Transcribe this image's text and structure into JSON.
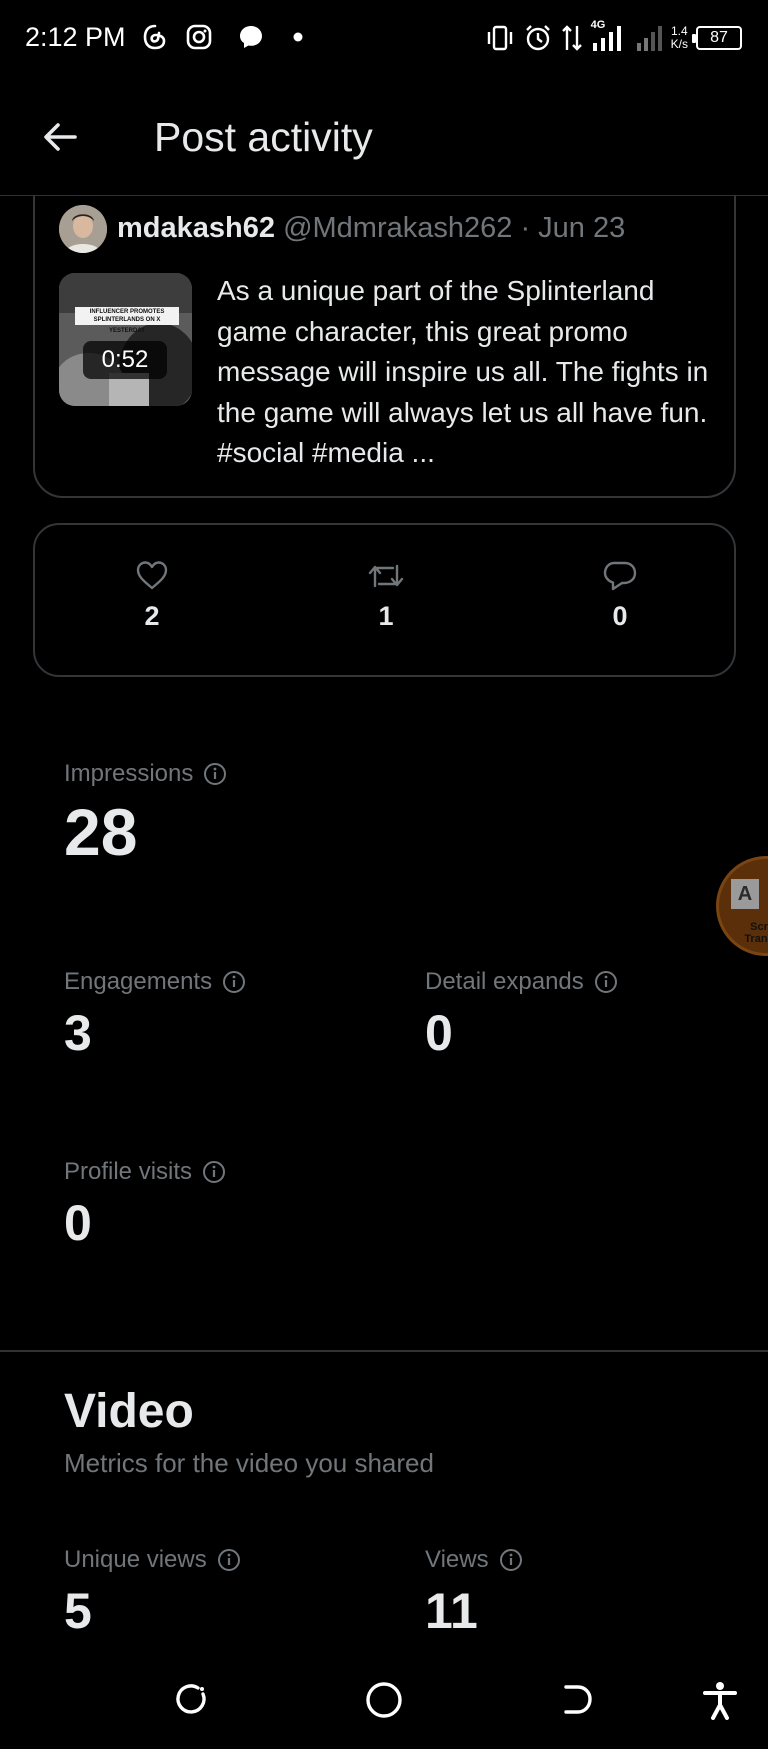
{
  "status_bar": {
    "time": "2:12 PM",
    "net_speed_value": "1.4",
    "net_speed_unit": "K/s",
    "network_type": "4G",
    "battery": "87",
    "icons": [
      "threads-icon",
      "instagram-icon",
      "messenger-icon",
      "notification-dot-icon",
      "vibrate-icon",
      "alarm-icon",
      "data-arrows-icon",
      "signal-icon",
      "signal-icon-2"
    ]
  },
  "header": {
    "title": "Post activity",
    "back_icon": "arrow-left-icon"
  },
  "post": {
    "author": "mdakash62",
    "handle": "@Mdmrakash262",
    "separator": "·",
    "date": "Jun 23",
    "text": "As a unique part of the Splinterland game character, this great promo message will inspire us all. The fights in the game will always let us all have fun. #social #media ...",
    "thumbnail": {
      "banner_line1": "INFLUENCER PROMOTES",
      "banner_line2": "SPLINTERLANDS ON X",
      "banner_line3": "YESTERDAY",
      "duration": "0:52"
    }
  },
  "engagement": {
    "likes": "2",
    "reposts": "1",
    "replies": "0"
  },
  "metrics": {
    "impressions": {
      "label": "Impressions",
      "value": "28"
    },
    "engagements": {
      "label": "Engagements",
      "value": "3"
    },
    "detail_expands": {
      "label": "Detail expands",
      "value": "0"
    },
    "profile_visits": {
      "label": "Profile visits",
      "value": "0"
    }
  },
  "video_section": {
    "title": "Video",
    "subtitle": "Metrics for the video you shared",
    "unique_views": {
      "label": "Unique views",
      "value": "5"
    },
    "views": {
      "label": "Views",
      "value": "11"
    }
  },
  "overlay": {
    "tab_letter": "A",
    "caption_line1": "Scr",
    "caption_line2": "Trans"
  },
  "colors": {
    "background": "#000000",
    "primary_text": "#e7e9ea",
    "secondary_text": "#71767b",
    "border": "#333639"
  }
}
